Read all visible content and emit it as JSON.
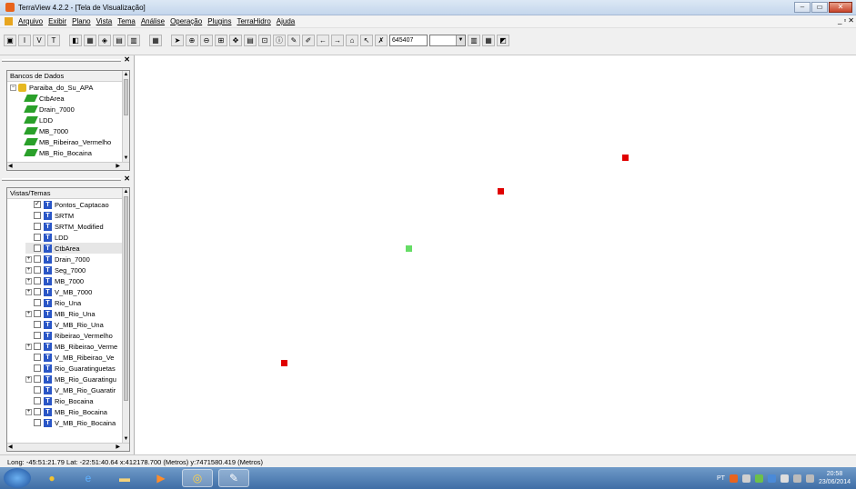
{
  "window": {
    "title": "TerraView 4.2.2 - [Tela de Visualização]"
  },
  "menu": [
    "Arquivo",
    "Exibir",
    "Plano",
    "Vista",
    "Tema",
    "Análise",
    "Operação",
    "Plugins",
    "TerraHidro",
    "Ajuda"
  ],
  "toolbar": {
    "scale_value": "645407"
  },
  "databases_panel": {
    "header": "Bancos de Dados",
    "database": "Paraiba_do_Su_APA",
    "layers": [
      "CtbArea",
      "Drain_7000",
      "LDD",
      "MB_7000",
      "MB_Ribeirao_Vermelho",
      "MB_Rio_Bocaina"
    ]
  },
  "views_panel": {
    "header": "Vistas/Temas",
    "themes": [
      {
        "label": "Pontos_Captacao",
        "checked": true,
        "expandable": false
      },
      {
        "label": "SRTM",
        "checked": false,
        "expandable": false
      },
      {
        "label": "SRTM_Modified",
        "checked": false,
        "expandable": false
      },
      {
        "label": "LDD",
        "checked": false,
        "expandable": false
      },
      {
        "label": "CtbArea",
        "checked": false,
        "expandable": false
      },
      {
        "label": "Drain_7000",
        "checked": false,
        "expandable": true
      },
      {
        "label": "Seg_7000",
        "checked": false,
        "expandable": true
      },
      {
        "label": "MB_7000",
        "checked": false,
        "expandable": true
      },
      {
        "label": "V_MB_7000",
        "checked": false,
        "expandable": true
      },
      {
        "label": "Rio_Una",
        "checked": false,
        "expandable": false
      },
      {
        "label": "MB_Rio_Una",
        "checked": false,
        "expandable": true
      },
      {
        "label": "V_MB_Rio_Una",
        "checked": false,
        "expandable": false
      },
      {
        "label": "Ribeirao_Vermelho",
        "checked": false,
        "expandable": false
      },
      {
        "label": "MB_Ribeirao_Verme",
        "checked": false,
        "expandable": true
      },
      {
        "label": "V_MB_Ribeirao_Ve",
        "checked": false,
        "expandable": false
      },
      {
        "label": "Rio_Guaratinguetas",
        "checked": false,
        "expandable": false
      },
      {
        "label": "MB_Rio_Guaratingu",
        "checked": false,
        "expandable": true
      },
      {
        "label": "V_MB_Rio_Guaratir",
        "checked": false,
        "expandable": false
      },
      {
        "label": "Rio_Bocaina",
        "checked": false,
        "expandable": false
      },
      {
        "label": "MB_Rio_Bocaina",
        "checked": false,
        "expandable": true
      },
      {
        "label": "V_MB_Rio_Bocaina",
        "checked": false,
        "expandable": false
      }
    ]
  },
  "map": {
    "points": [
      {
        "color": "#e00000"
      },
      {
        "color": "#e00000"
      },
      {
        "color": "#66dd66"
      },
      {
        "color": "#e00000"
      }
    ]
  },
  "statusbar": {
    "text": "Long: -45:51:21.79 Lat: -22:51:40.64 x:412178.700 (Metros) y:7471580.419 (Metros)"
  },
  "taskbar": {
    "language": "PT",
    "time": "20:58",
    "date": "23/06/2014"
  }
}
